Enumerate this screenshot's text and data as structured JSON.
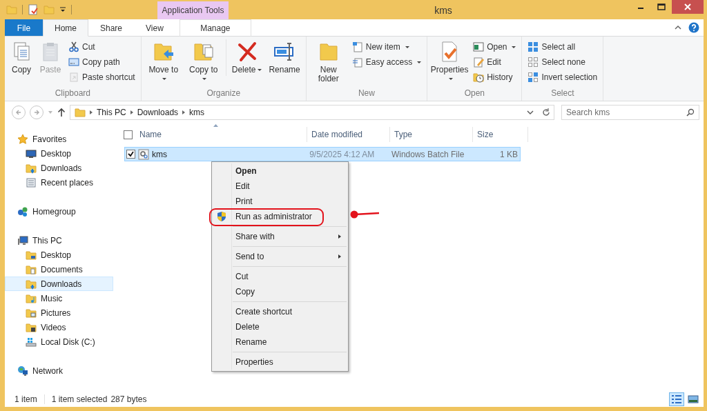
{
  "window": {
    "title": "kms",
    "contextual_tab": "Application Tools"
  },
  "ribbon_tabs": [
    {
      "label": "File",
      "kind": "file",
      "selected": false
    },
    {
      "label": "Home",
      "kind": "tab",
      "selected": true
    },
    {
      "label": "Share",
      "kind": "tab",
      "selected": false
    },
    {
      "label": "View",
      "kind": "tab",
      "selected": false
    },
    {
      "label": "Manage",
      "kind": "contextual",
      "selected": false
    }
  ],
  "ribbon_groups": [
    {
      "label": "Clipboard",
      "items": [
        {
          "kind": "large",
          "label": "Copy",
          "dropdown": false,
          "disabled": false
        },
        {
          "kind": "large",
          "label": "Paste",
          "dropdown": false,
          "disabled": true
        },
        {
          "kind": "small",
          "label": "Cut",
          "dropdown": false,
          "disabled": false
        },
        {
          "kind": "small",
          "label": "Copy path",
          "dropdown": false,
          "disabled": false
        },
        {
          "kind": "small",
          "label": "Paste shortcut",
          "dropdown": false,
          "disabled": true
        }
      ]
    },
    {
      "label": "Organize",
      "items": [
        {
          "kind": "large",
          "label": "Move to",
          "dropdown": true,
          "disabled": false
        },
        {
          "kind": "large",
          "label": "Copy to",
          "dropdown": true,
          "disabled": false
        },
        {
          "kind": "divider"
        },
        {
          "kind": "large",
          "label": "Delete",
          "dropdown": true,
          "disabled": false
        },
        {
          "kind": "large",
          "label": "Rename",
          "dropdown": false,
          "disabled": false
        }
      ]
    },
    {
      "label": "New",
      "items": [
        {
          "kind": "large",
          "label": "New folder",
          "dropdown": false,
          "disabled": false
        },
        {
          "kind": "small",
          "label": "New item",
          "dropdown": true,
          "disabled": false
        },
        {
          "kind": "small",
          "label": "Easy access",
          "dropdown": true,
          "disabled": false
        }
      ]
    },
    {
      "label": "Open",
      "items": [
        {
          "kind": "large",
          "label": "Properties",
          "dropdown": true,
          "disabled": false
        },
        {
          "kind": "small",
          "label": "Open",
          "dropdown": true,
          "disabled": false
        },
        {
          "kind": "small",
          "label": "Edit",
          "dropdown": false,
          "disabled": false
        },
        {
          "kind": "small",
          "label": "History",
          "dropdown": false,
          "disabled": false
        }
      ]
    },
    {
      "label": "Select",
      "items": [
        {
          "kind": "small",
          "label": "Select all",
          "dropdown": false,
          "disabled": false
        },
        {
          "kind": "small",
          "label": "Select none",
          "dropdown": false,
          "disabled": false
        },
        {
          "kind": "small",
          "label": "Invert selection",
          "dropdown": false,
          "disabled": false
        }
      ]
    }
  ],
  "address": {
    "path": [
      "This PC",
      "Downloads",
      "kms"
    ]
  },
  "search": {
    "placeholder": "Search kms"
  },
  "navigation": [
    {
      "label": "Favorites",
      "selected": false,
      "children": [
        {
          "label": "Desktop",
          "selected": false
        },
        {
          "label": "Downloads",
          "selected": false
        },
        {
          "label": "Recent places",
          "selected": false
        }
      ]
    },
    {
      "label": "Homegroup",
      "selected": false
    },
    {
      "label": "This PC",
      "selected": false,
      "children": [
        {
          "label": "Desktop",
          "selected": false
        },
        {
          "label": "Documents",
          "selected": false
        },
        {
          "label": "Downloads",
          "selected": true
        },
        {
          "label": "Music",
          "selected": false
        },
        {
          "label": "Pictures",
          "selected": false
        },
        {
          "label": "Videos",
          "selected": false
        },
        {
          "label": "Local Disk (C:)",
          "selected": false
        }
      ]
    },
    {
      "label": "Network",
      "selected": false
    }
  ],
  "file_list": {
    "select_all_checked": false,
    "columns": [
      "Name",
      "Date modified",
      "Type",
      "Size"
    ],
    "rows": [
      {
        "name": "kms",
        "date_modified": "9/5/2025 4:12 AM",
        "type": "Windows Batch File",
        "size": "1 KB",
        "selected": true,
        "checked": true
      }
    ]
  },
  "context_menu": {
    "sections": [
      [
        {
          "label": "Open",
          "default": true,
          "submenu": false,
          "shield": false,
          "highlighted": false
        },
        {
          "label": "Edit",
          "default": false,
          "submenu": false,
          "shield": false,
          "highlighted": false
        },
        {
          "label": "Print",
          "default": false,
          "submenu": false,
          "shield": false,
          "highlighted": false
        },
        {
          "label": "Run as administrator",
          "default": false,
          "submenu": false,
          "shield": true,
          "highlighted": true
        }
      ],
      [
        {
          "label": "Share with",
          "default": false,
          "submenu": true,
          "shield": false,
          "highlighted": false
        }
      ],
      [
        {
          "label": "Send to",
          "default": false,
          "submenu": true,
          "shield": false,
          "highlighted": false
        }
      ],
      [
        {
          "label": "Cut",
          "default": false,
          "submenu": false,
          "shield": false,
          "highlighted": false
        },
        {
          "label": "Copy",
          "default": false,
          "submenu": false,
          "shield": false,
          "highlighted": false
        }
      ],
      [
        {
          "label": "Create shortcut",
          "default": false,
          "submenu": false,
          "shield": false,
          "highlighted": false
        },
        {
          "label": "Delete",
          "default": false,
          "submenu": false,
          "shield": false,
          "highlighted": false
        },
        {
          "label": "Rename",
          "default": false,
          "submenu": false,
          "shield": false,
          "highlighted": false
        }
      ],
      [
        {
          "label": "Properties",
          "default": false,
          "submenu": false,
          "shield": false,
          "highlighted": false
        }
      ]
    ]
  },
  "status_bar": {
    "item_count": "1 item",
    "selection": "1 item selected",
    "size": "287 bytes",
    "views": [
      {
        "kind": "details",
        "selected": true
      },
      {
        "kind": "large_icons",
        "selected": false
      }
    ]
  }
}
